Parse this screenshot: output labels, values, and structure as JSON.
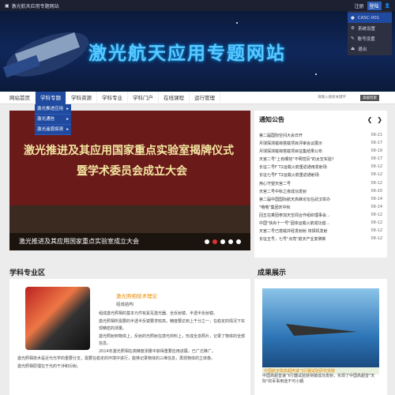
{
  "topbar": {
    "site_title": "激光航天应用专题网站",
    "register": "注册",
    "login": "登陆"
  },
  "user_menu": [
    "CASC-001",
    "系统设置",
    "账号设置",
    "退出"
  ],
  "banner": {
    "title": "激光航天应用专题网站"
  },
  "nav": {
    "items": [
      "网站首页",
      "学科专题",
      "学科资源",
      "学科专业",
      "学科门户",
      "在线课程",
      "运行管理"
    ],
    "search_placeholder": "请输入搜索关键字",
    "search_button": "高级检索"
  },
  "sub_dropdown": [
    "激光推进应用",
    "激光通信",
    "激光遥感探测"
  ],
  "slider": {
    "banner_line1": "激光推进及其应用国家重点实验室揭牌仪式",
    "banner_line2": "暨学术委员会成立大会",
    "caption": "激光推进及其应用国家重点实验室成立大会"
  },
  "notice": {
    "title": "通知公告",
    "items": [
      {
        "text": "第二届国际空间大会日开",
        "date": "09-21"
      },
      {
        "text": "月球探测载荷搭载项目评审会议展示",
        "date": "09-17"
      },
      {
        "text": "月球探测载荷搭载项目征集结果公布",
        "date": "09-19"
      },
      {
        "text": "天宫二号\"上有哪些\"不明觉厉\"的太空实验?",
        "date": "09-17"
      },
      {
        "text": "长征二号F T2运载火箭重返通用发射场",
        "date": "09-12"
      },
      {
        "text": "长征七号F T2运载火箭重返通射场",
        "date": "09-12"
      },
      {
        "text": "用心守望天宫二号",
        "date": "09-12"
      },
      {
        "text": "天宫二号中秋之夜成功发射",
        "date": "09-20"
      },
      {
        "text": "第二届中国国际航天高峰论坛在武汉举办",
        "date": "09-14"
      },
      {
        "text": "\"哦哦\"集团庆中秋",
        "date": "09-14"
      },
      {
        "text": "回五在乘团参加天空闻合作组织理事会...",
        "date": "09-12"
      },
      {
        "text": "中国\"快舟十一号\"固体运载火箭成功首...",
        "date": "09-12"
      },
      {
        "text": "天宫二号已搭载并经发射射 将择机发射",
        "date": "09-12"
      },
      {
        "text": "长征五号，七号\"点亮\"航天产业复牌新",
        "date": "09-12"
      }
    ]
  },
  "subject": {
    "section_title": "学科专业区",
    "item_title": "激光照相技术理论",
    "item_sub": "组成结构",
    "paragraphs": [
      "组成激光照相的基本元件有氦氖激光器、全反射镜、半透半反射镜。",
      "激光照相所需要的半透半反镜要求较高，精度要达到上千分之一，在稳定的情况下实现精密的测量。",
      "激光照射到物体上，反射的光照射在感光材料上，形成全息照片，记录了物体的全部信息。",
      "2014年激光照相在高精度测量中获得重要应用进展，已广泛推广。",
      "激光照相技术是近代光学的重要分支，需要在稳定的环境中进行，能够记录物体的三维信息，再现物体的立体像。",
      "激光照相原理在于光的干涉和衍射。"
    ]
  },
  "results": {
    "section_title": "成果展示",
    "item_title": "中国航天院高超声速飞行器试验研究突破",
    "item_text": "中国高超音速飞行器试验获突破成功发射，实现了中国高超音\"天际\"的军事用途不可小觑"
  }
}
